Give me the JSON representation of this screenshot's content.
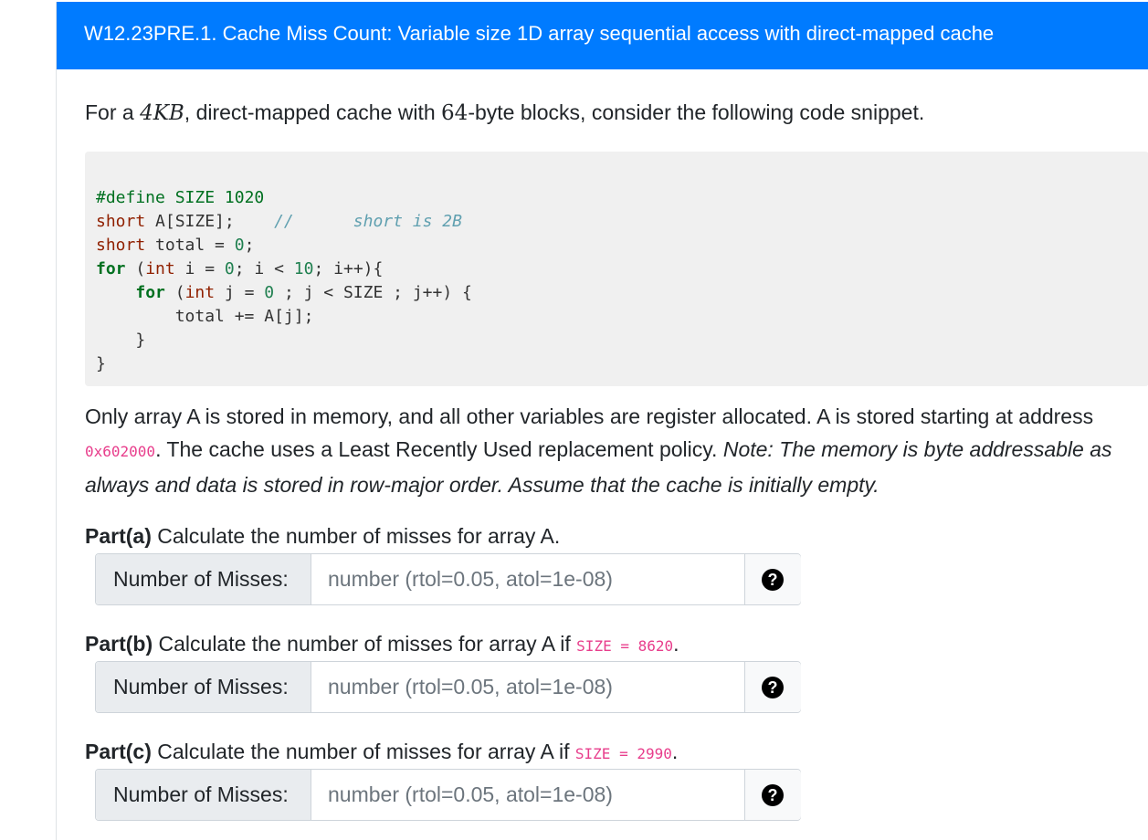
{
  "header": {
    "title": "W12.23PRE.1. Cache Miss Count: Variable size 1D array sequential access with direct-mapped cache"
  },
  "intro": {
    "prefix": "For a ",
    "cache_size": "4KB",
    "middle": ", direct-mapped cache with ",
    "block_size": "64",
    "suffix": "-byte blocks, consider the following code snippet."
  },
  "code": {
    "line1_pre": "#define SIZE ",
    "line1_num": "1020",
    "line2_type": "short",
    "line2_rest": " A[SIZE];    ",
    "line2_comment": "//      short is 2B",
    "line3_type": "short",
    "line3_rest": " total = ",
    "line3_num": "0",
    "line3_end": ";",
    "line4_kw": "for",
    "line4_a": " (",
    "line4_type": "int",
    "line4_b": " i = ",
    "line4_num0": "0",
    "line4_c": "; i < ",
    "line4_num10": "10",
    "line4_d": "; i++){",
    "line5_kw": "for",
    "line5_a": " (",
    "line5_type": "int",
    "line5_b": " j = ",
    "line5_num": "0",
    "line5_c": " ; j < SIZE ; j++) {",
    "line6": "        total += A[j];",
    "line7": "    }",
    "line8": "}"
  },
  "description": {
    "text1": "Only array A is stored in memory, and all other variables are register allocated. A is stored starting at address ",
    "address": "0x602000",
    "text2": ". The cache uses a Least Recently Used replacement policy. ",
    "note": "Note: The memory is byte addressable as always and data is stored in row-major order. Assume that the cache is initially empty."
  },
  "parts": [
    {
      "label": "Part(a)",
      "question": " Calculate the number of misses for array A.",
      "code": "",
      "end": "",
      "answer_label": "Number of Misses:",
      "placeholder": "number (rtol=0.05, atol=1e-08)"
    },
    {
      "label": "Part(b)",
      "question": " Calculate the number of misses for array A if ",
      "code": "SIZE = 8620",
      "end": ".",
      "answer_label": "Number of Misses:",
      "placeholder": "number (rtol=0.05, atol=1e-08)"
    },
    {
      "label": "Part(c)",
      "question": " Calculate the number of misses for array A if ",
      "code": "SIZE = 2990",
      "end": ".",
      "answer_label": "Number of Misses:",
      "placeholder": "number (rtol=0.05, atol=1e-08)"
    }
  ],
  "help_icon_glyph": "?",
  "colors": {
    "header_bg": "#007bff",
    "code_bg": "#f0f0f0",
    "inline_code": "#e83e8c"
  }
}
